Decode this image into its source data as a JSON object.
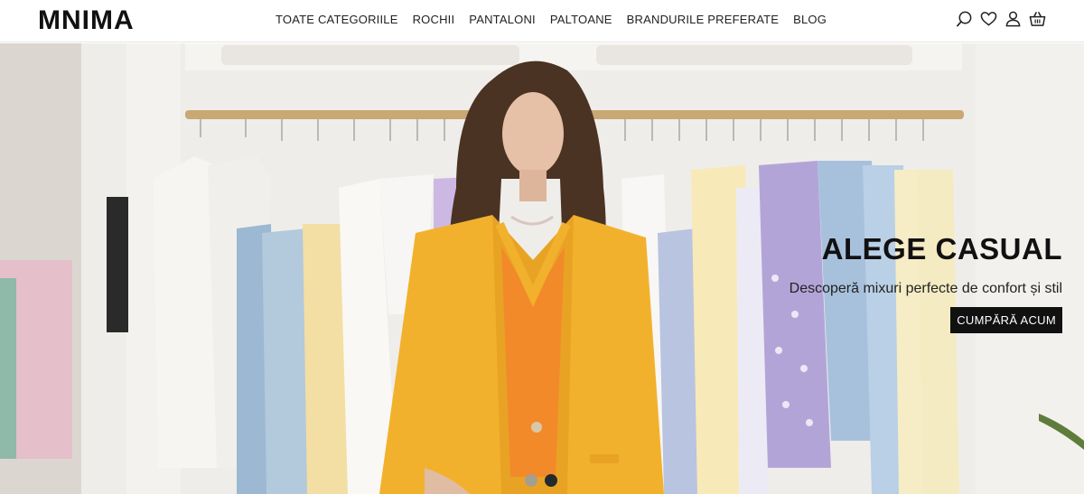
{
  "brand": {
    "logo_text": "MNIMA"
  },
  "nav": {
    "items": [
      {
        "label": "TOATE CATEGORIILE"
      },
      {
        "label": "ROCHII"
      },
      {
        "label": "PANTALONI"
      },
      {
        "label": "PALTOANE"
      },
      {
        "label": "BRANDURILE PREFERATE"
      },
      {
        "label": "BLOG"
      }
    ]
  },
  "header_icons": [
    "search-icon",
    "heart-icon",
    "user-icon",
    "basket-icon"
  ],
  "hero": {
    "title": "ALEGE CASUAL",
    "subtitle": "Descoperă mixuri perfecte de confort și stil",
    "cta_label": "CUMPĂRĂ ACUM",
    "slides_total": 2,
    "active_slide": 2
  },
  "colors": {
    "cta_background": "#111111",
    "blazer": "#f2b12c",
    "sweater": "#f28a2a",
    "rail": "#c9a873"
  }
}
